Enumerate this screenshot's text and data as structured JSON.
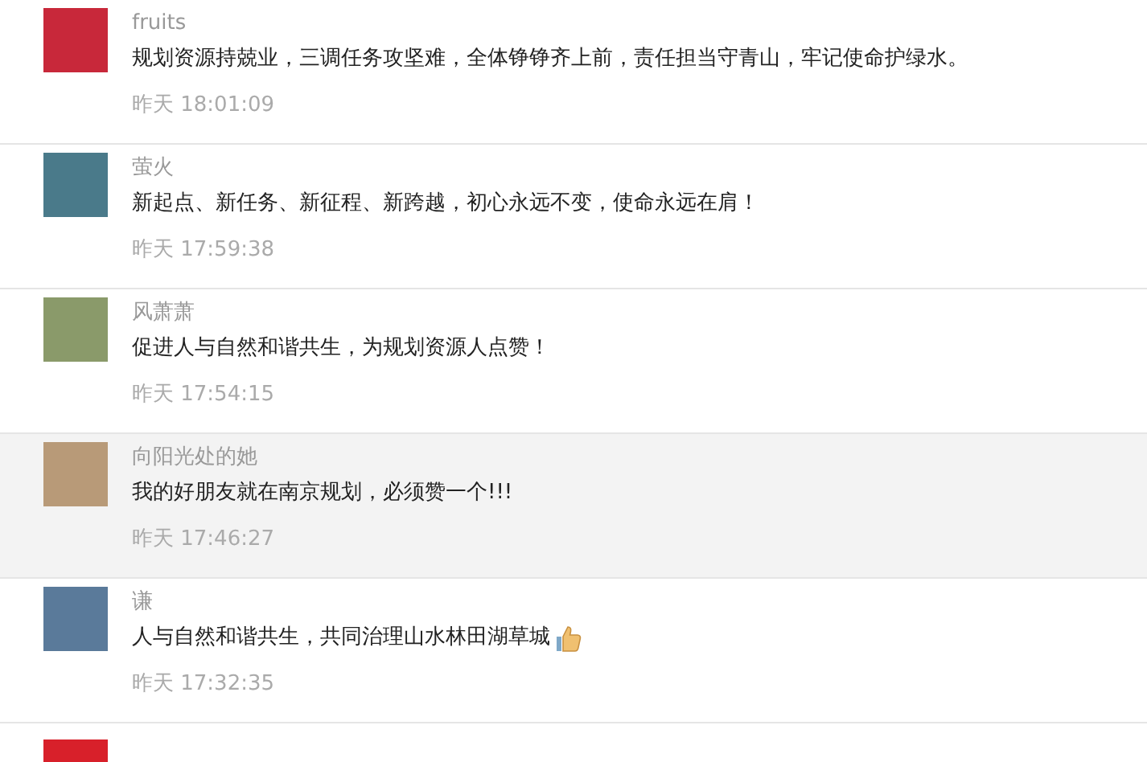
{
  "comments": [
    {
      "name": "fruits",
      "text": "规划资源持兢业，三调任务攻坚难，全体铮铮齐上前，责任担当守青山，牢记使命护绿水。",
      "time": "昨天 18:01:09",
      "highlighted": false,
      "thumbs_up": false
    },
    {
      "name": "萤火",
      "text": "新起点、新任务、新征程、新跨越，初心永远不变，使命永远在肩！",
      "time": "昨天 17:59:38",
      "highlighted": false,
      "thumbs_up": false
    },
    {
      "name": "风萧萧",
      "text": "促进人与自然和谐共生，为规划资源人点赞！",
      "time": "昨天 17:54:15",
      "highlighted": false,
      "thumbs_up": false
    },
    {
      "name": "向阳光处的她",
      "text": "我的好朋友就在南京规划，必须赞一个!!!",
      "time": "昨天 17:46:27",
      "highlighted": true,
      "thumbs_up": false
    },
    {
      "name": "谦",
      "text": "人与自然和谐共生，共同治理山水林田湖草城",
      "time": "昨天 17:32:35",
      "highlighted": false,
      "thumbs_up": true
    }
  ],
  "more_below": true
}
